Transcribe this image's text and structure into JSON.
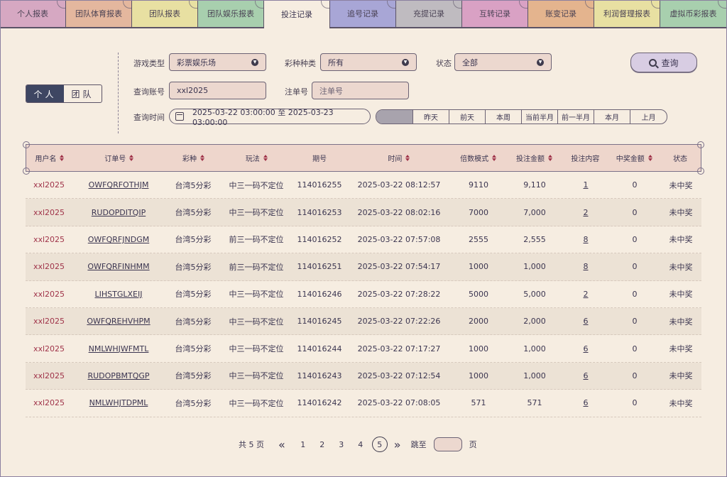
{
  "tabs": [
    {
      "label": "个人报表",
      "color": "#d6a8c2"
    },
    {
      "label": "团队体育报表",
      "color": "#e4b79e"
    },
    {
      "label": "团队报表",
      "color": "#e8e0a2"
    },
    {
      "label": "团队娱乐报表",
      "color": "#a8cfae"
    },
    {
      "label": "投注记录",
      "color": "#f6ede1"
    },
    {
      "label": "追号记录",
      "color": "#a8a6d6"
    },
    {
      "label": "充提记录",
      "color": "#bfbbc0"
    },
    {
      "label": "互转记录",
      "color": "#d9a1c4"
    },
    {
      "label": "账变记录",
      "color": "#e4b48e"
    },
    {
      "label": "利润督理报表",
      "color": "#e8e0a2"
    },
    {
      "label": "虚拟币彩报表",
      "color": "#a8cfae"
    }
  ],
  "toggle": {
    "personal": "个人",
    "team": "团队"
  },
  "filters": {
    "game_type_label": "游戏类型",
    "game_type_value": "彩票娱乐场",
    "lottery_kind_label": "彩种种类",
    "lottery_kind_value": "所有",
    "status_label": "状态",
    "status_value": "全部",
    "account_label": "查询账号",
    "account_value": "xxl2025",
    "order_label": "注单号",
    "order_placeholder": "注单号",
    "time_label": "查询时间",
    "time_range": "2025-03-22 03:00:00 至 2025-03-23 03:00:00",
    "quick_ranges": [
      "",
      "昨天",
      "前天",
      "本周",
      "当前半月",
      "前一半月",
      "本月",
      "上月"
    ],
    "query_button": "查询"
  },
  "table": {
    "headers": [
      "用户名",
      "订单号",
      "彩种",
      "玩法",
      "期号",
      "时间",
      "倍数模式",
      "投注金额",
      "投注内容",
      "中奖金额",
      "状态"
    ],
    "rows": [
      [
        "xxl2025",
        "OWFQRFOTHJM",
        "台湾5分彩",
        "中三一码不定位",
        "114016255",
        "2025-03-22 08:12:57",
        "9110",
        "9,110",
        "1",
        "0",
        "未中奖"
      ],
      [
        "xxl2025",
        "RUDOPDITQIP",
        "台湾5分彩",
        "中三一码不定位",
        "114016253",
        "2025-03-22 08:02:16",
        "7000",
        "7,000",
        "2",
        "0",
        "未中奖"
      ],
      [
        "xxl2025",
        "OWFQRFJNDGM",
        "台湾5分彩",
        "前三一码不定位",
        "114016252",
        "2025-03-22 07:57:08",
        "2555",
        "2,555",
        "8",
        "0",
        "未中奖"
      ],
      [
        "xxl2025",
        "OWFQRFINHMM",
        "台湾5分彩",
        "前三一码不定位",
        "114016251",
        "2025-03-22 07:54:17",
        "1000",
        "1,000",
        "8",
        "0",
        "未中奖"
      ],
      [
        "xxl2025",
        "LIHSTGLXEIJ",
        "台湾5分彩",
        "中三一码不定位",
        "114016246",
        "2025-03-22 07:28:22",
        "5000",
        "5,000",
        "2",
        "0",
        "未中奖"
      ],
      [
        "xxl2025",
        "OWFQREHVHPM",
        "台湾5分彩",
        "中三一码不定位",
        "114016245",
        "2025-03-22 07:22:26",
        "2000",
        "2,000",
        "6",
        "0",
        "未中奖"
      ],
      [
        "xxl2025",
        "NMLWHJWFMTL",
        "台湾5分彩",
        "中三一码不定位",
        "114016244",
        "2025-03-22 07:17:27",
        "1000",
        "1,000",
        "6",
        "0",
        "未中奖"
      ],
      [
        "xxl2025",
        "RUDOPBMTQGP",
        "台湾5分彩",
        "中三一码不定位",
        "114016243",
        "2025-03-22 07:12:54",
        "1000",
        "1,000",
        "6",
        "0",
        "未中奖"
      ],
      [
        "xxl2025",
        "NMLWHJTDPML",
        "台湾5分彩",
        "中三一码不定位",
        "114016242",
        "2025-03-22 07:08:05",
        "571",
        "571",
        "6",
        "0",
        "未中奖"
      ]
    ]
  },
  "pagination": {
    "total": "共 5 页",
    "pages": [
      "1",
      "2",
      "3",
      "4",
      "5"
    ],
    "current": "5",
    "jump_label": "跳至",
    "page_suffix": "页"
  }
}
